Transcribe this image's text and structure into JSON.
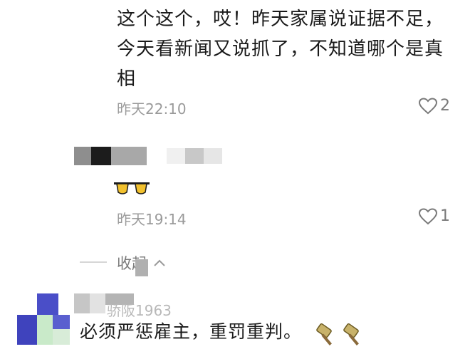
{
  "comment1": {
    "text_lines": [
      "这个这个，哎！昨天家属说证据不足，",
      "今天看新闻又说抓了，不知道哪个是真",
      "相"
    ],
    "time": "昨天22:10",
    "likes": "2"
  },
  "comment2": {
    "time": "昨天19:14",
    "likes": "1"
  },
  "collapse_label": "收起",
  "reply": {
    "username": "骄阪1963",
    "text": "必须严惩雇主，重罚重判。"
  },
  "icons": [
    "heart-outline-icon",
    "chevron-up-icon",
    "avatar",
    "hammer-emoji-icon",
    "sunglasses-emoji-icon"
  ]
}
